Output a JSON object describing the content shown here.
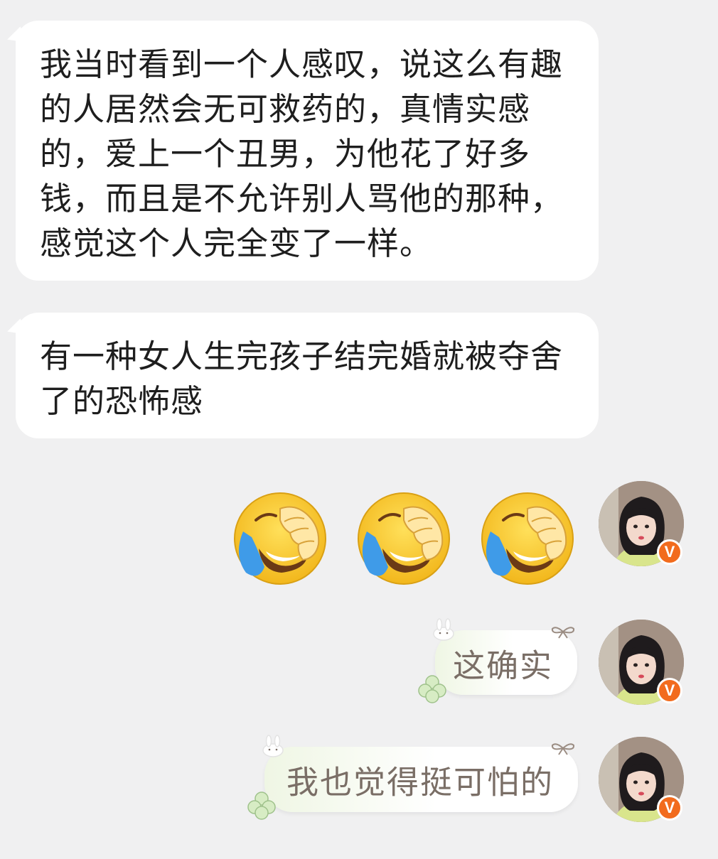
{
  "messages": [
    {
      "id": "msg1",
      "side": "left",
      "text": "我当时看到一个人感叹，说这么有趣的人居然会无可救药的，真情实感的，爱上一个丑男，为他花了好多钱，而且是不允许别人骂他的那种，感觉这个人完全变了一样。"
    },
    {
      "id": "msg2",
      "side": "left",
      "text": "有一种女人生完孩子结完婚就被夺舍了的恐怖感"
    },
    {
      "id": "msg3",
      "side": "right",
      "type": "emoji",
      "emojis": [
        "face-with-tears-of-joy-covering-face-icon",
        "face-with-tears-of-joy-covering-face-icon",
        "face-with-tears-of-joy-covering-face-icon"
      ]
    },
    {
      "id": "msg4",
      "side": "right",
      "text": "这确实"
    },
    {
      "id": "msg5",
      "side": "right",
      "text": "我也觉得挺可怕的"
    }
  ],
  "avatar": {
    "badge": "V",
    "badge_color": "#f26b1d"
  },
  "colors": {
    "background": "#f0f0f1",
    "left_bubble": "#ffffff",
    "right_bubble_tint": "#eff6e4",
    "right_text": "#7a6e66"
  }
}
